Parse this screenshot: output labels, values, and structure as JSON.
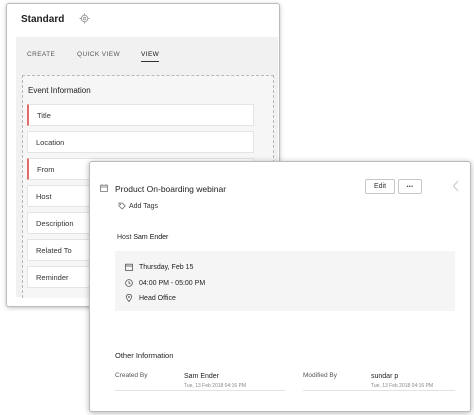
{
  "layout_panel": {
    "title": "Standard",
    "tabs": [
      {
        "label": "CREATE"
      },
      {
        "label": "QUICK VIEW"
      },
      {
        "label": "VIEW"
      }
    ],
    "section_title": "Event Information",
    "fields": [
      {
        "label": "Title",
        "mandatory": true
      },
      {
        "label": "Location",
        "mandatory": false
      },
      {
        "label": "From",
        "mandatory": true
      },
      {
        "label": "Host",
        "mandatory": false
      },
      {
        "label": "Description",
        "mandatory": false
      },
      {
        "label": "Related To",
        "mandatory": false
      },
      {
        "label": "Reminder",
        "mandatory": false
      }
    ]
  },
  "event_card": {
    "title": "Product On-boarding webinar",
    "edit_label": "Edit",
    "more_label": "•••",
    "add_tags_label": "Add Tags",
    "host_label": "Host",
    "host_name": "Sam Ender",
    "date": "Thursday, Feb 15",
    "time": "04:00 PM - 05:00 PM",
    "location": "Head Office",
    "other_info_title": "Other Information",
    "created_by_label": "Created By",
    "created_by_name": "Sam Ender",
    "created_by_time": "Tue, 13 Feb 2018 04:16 PM",
    "modified_by_label": "Modified By",
    "modified_by_name": "sundar p",
    "modified_by_time": "Tue, 13 Feb 2018 04:16 PM"
  },
  "colors": {
    "mandatory_marker": "#e06b6b",
    "panel_background": "#f1f1f1",
    "detail_background": "#f5f5f5"
  },
  "icons": [
    "gear-icon",
    "calendar-icon",
    "tag-icon",
    "clock-icon",
    "location-pin-icon",
    "chevron-left-icon"
  ]
}
